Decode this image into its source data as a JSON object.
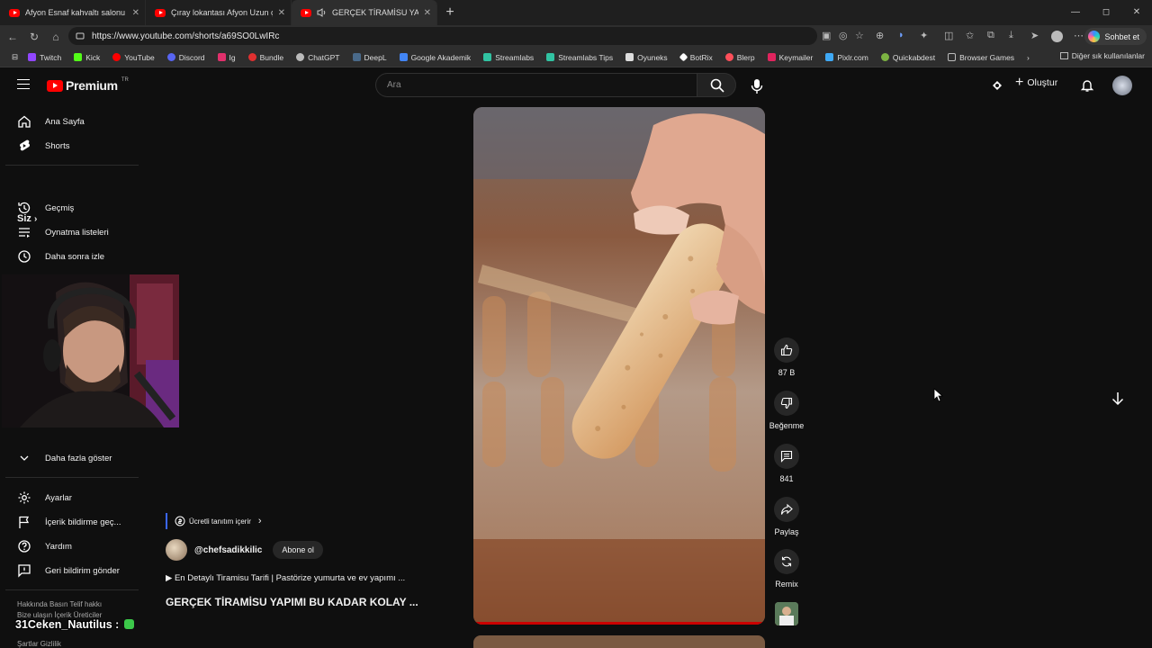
{
  "tabs": [
    {
      "title": "Afyon Esnaf kahvaltı salonu Coğraf",
      "close": "✕"
    },
    {
      "title": "Çıray lokantası Afyon Uzun çarşı #",
      "close": "✕"
    },
    {
      "title": "GERÇEK TİRAMİSU YAPIMI BU",
      "close": "✕"
    }
  ],
  "new_tab": "+",
  "window_controls": {
    "minimize": "—",
    "maximize": "◻",
    "close": "✕"
  },
  "address": {
    "url": "https://www.youtube.com/shorts/a69SO0LwIRc"
  },
  "copilot_label": "Sohbet et",
  "bookmarks": [
    {
      "label": "Twitch",
      "color": "#9146ff"
    },
    {
      "label": "Kick",
      "color": "#53fc18"
    },
    {
      "label": "YouTube",
      "color": "#ff0000"
    },
    {
      "label": "Discord",
      "color": "#5865f2"
    },
    {
      "label": "Ig",
      "color": "#e1306c"
    },
    {
      "label": "Bundle",
      "color": "#e03030"
    },
    {
      "label": "ChatGPT",
      "color": "#bbbbbb"
    },
    {
      "label": "DeepL",
      "color": "#0f2b46"
    },
    {
      "label": "Google Akademik",
      "color": "#4285f4"
    },
    {
      "label": "Streamlabs",
      "color": "#31c3a2"
    },
    {
      "label": "Streamlabs Tips",
      "color": "#31c3a2"
    },
    {
      "label": "Oyuneks",
      "color": "#dddddd"
    },
    {
      "label": "BotRix",
      "color": "#ffffff"
    },
    {
      "label": "Blerp",
      "color": "#ff4f5a"
    },
    {
      "label": "Keymailer",
      "color": "#e0245e"
    },
    {
      "label": "Pixlr.com",
      "color": "#3fa9f5"
    },
    {
      "label": "Quickabdest",
      "color": "#7cb342"
    },
    {
      "label": "Browser Games",
      "color": "#888888"
    }
  ],
  "bookmarks_more": "Diğer sık kullanılanlar",
  "youtube": {
    "logo_text": "Premium",
    "logo_region": "TR",
    "search_placeholder": "Ara",
    "create_label": "Oluştur",
    "sidebar": {
      "home": "Ana Sayfa",
      "shorts": "Shorts",
      "you": "Siz",
      "history": "Geçmiş",
      "playlists": "Oynatma listeleri",
      "watch_later": "Daha sonra izle",
      "show_more": "Daha fazla göster",
      "settings": "Ayarlar",
      "report": "İçerik bildirme geç...",
      "help": "Yardım",
      "feedback": "Geri bildirim gönder",
      "footer1": "Hakkında  Basın  Telif hakkı",
      "footer2": "Bize ulaşın  İçerik Üreticiler",
      "footer3": "Şartlar  Gizlilik"
    },
    "overlay_name": "31Ceken_Nautilus :",
    "short": {
      "promo": "Ücretli tanıtım içerir",
      "channel": "@chefsadikkilic",
      "subscribe": "Abone ol",
      "description": "▶ En Detaylı Tiramisu Tarifi | Pastörize yumurta ve ev yapımı ...",
      "title": "GERÇEK TİRAMİSU YAPIMI BU KADAR KOLAY ...",
      "likes": "87 B",
      "dislike": "Beğenme",
      "comments": "841",
      "share": "Paylaş",
      "remix": "Remix"
    }
  }
}
